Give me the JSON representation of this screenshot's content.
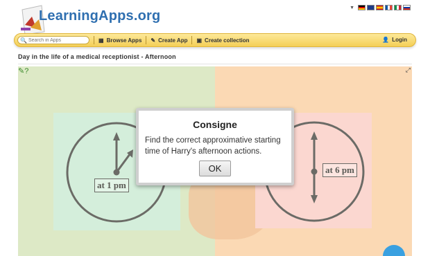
{
  "header": {
    "logo_text": "LearningApps.org",
    "language_flags": [
      "de",
      "en",
      "es",
      "fr",
      "it",
      "ru"
    ]
  },
  "toolbar": {
    "search_placeholder": "Search in Apps",
    "browse_label": "Browse Apps",
    "create_app_label": "Create App",
    "create_collection_label": "Create collection",
    "login_label": "Login"
  },
  "page": {
    "title": "Day in the life of a medical receptionist - Afternoon"
  },
  "app": {
    "left_clock_label": "at 1 pm",
    "right_clock_label": "at 6 pm"
  },
  "dialog": {
    "title": "Consigne",
    "message": "Find the correct approximative starting time of Harry's afternoon actions.",
    "ok_label": "OK"
  },
  "colors": {
    "toolbar_yellow": "#f4cf56",
    "logo_blue": "#2f6fb0",
    "left_bg": "#dde9c6",
    "right_bg": "#fbd9b4"
  }
}
